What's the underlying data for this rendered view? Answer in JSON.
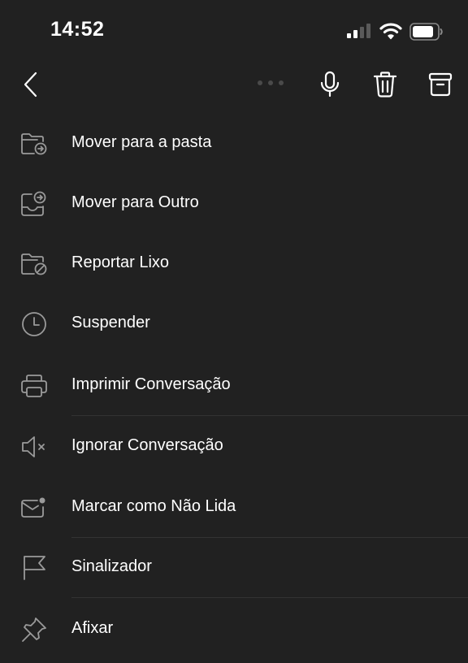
{
  "status_bar": {
    "time": "14:52",
    "signal_icon": "cellular-signal-icon",
    "wifi_icon": "wifi-icon",
    "battery_icon": "battery-icon"
  },
  "toolbar": {
    "back_icon": "chevron-left-icon",
    "more_icon": "more-dots-icon",
    "mic_icon": "microphone-icon",
    "trash_icon": "trash-icon",
    "archive_icon": "archive-icon"
  },
  "menu": {
    "items": [
      {
        "label": "Mover para a pasta",
        "icon": "move-to-folder-icon"
      },
      {
        "label": "Mover para Outro",
        "icon": "move-to-other-icon"
      },
      {
        "label": "Reportar Lixo",
        "icon": "report-junk-icon"
      },
      {
        "label": "Suspender",
        "icon": "clock-icon"
      },
      {
        "label": "Imprimir Conversação",
        "icon": "printer-icon"
      },
      {
        "label": "Ignorar Conversação",
        "icon": "mute-icon"
      },
      {
        "label": "Marcar como Não Lida",
        "icon": "mark-unread-icon"
      },
      {
        "label": "Sinalizador",
        "icon": "flag-icon"
      },
      {
        "label": "Afixar",
        "icon": "pin-icon"
      }
    ]
  },
  "colors": {
    "background": "#212121",
    "text": "#ffffff",
    "icon": "#9a9a9a",
    "divider": "#333333"
  }
}
